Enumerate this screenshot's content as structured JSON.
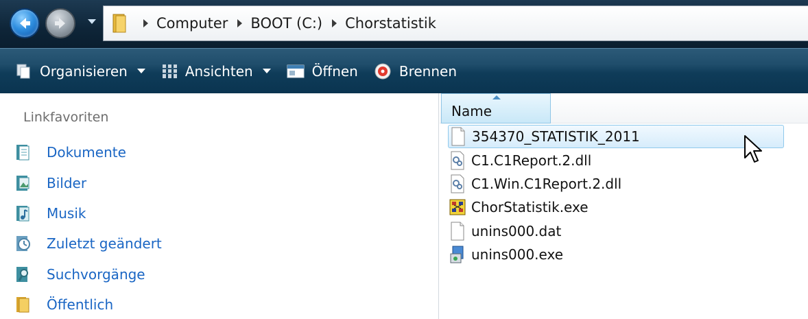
{
  "address_bar": {
    "breadcrumbs": [
      "Computer",
      "BOOT (C:)",
      "Chorstatistik"
    ]
  },
  "command_bar": {
    "organize_label": "Organisieren",
    "views_label": "Ansichten",
    "open_label": "Öffnen",
    "burn_label": "Brennen"
  },
  "nav_pane": {
    "header": "Linkfavoriten",
    "items": [
      {
        "label": "Dokumente",
        "icon": "documents-icon"
      },
      {
        "label": "Bilder",
        "icon": "pictures-icon"
      },
      {
        "label": "Musik",
        "icon": "music-icon"
      },
      {
        "label": "Zuletzt geändert",
        "icon": "recent-icon"
      },
      {
        "label": "Suchvorgänge",
        "icon": "searches-icon"
      },
      {
        "label": "Öffentlich",
        "icon": "public-folder-icon"
      }
    ]
  },
  "file_pane": {
    "column_name": "Name",
    "files": [
      {
        "name": "354370_STATISTIK_2011",
        "icon": "blank-file-icon",
        "selected": true
      },
      {
        "name": "C1.C1Report.2.dll",
        "icon": "dll-file-icon",
        "selected": false
      },
      {
        "name": "C1.Win.C1Report.2.dll",
        "icon": "dll-file-icon",
        "selected": false
      },
      {
        "name": "ChorStatistik.exe",
        "icon": "app-exe-icon",
        "selected": false
      },
      {
        "name": "unins000.dat",
        "icon": "blank-file-icon",
        "selected": false
      },
      {
        "name": "unins000.exe",
        "icon": "installer-exe-icon",
        "selected": false
      }
    ]
  },
  "colors": {
    "link_blue": "#1a66c4",
    "command_bar": "#1f4d6b",
    "selection": "#d6ecfb"
  }
}
